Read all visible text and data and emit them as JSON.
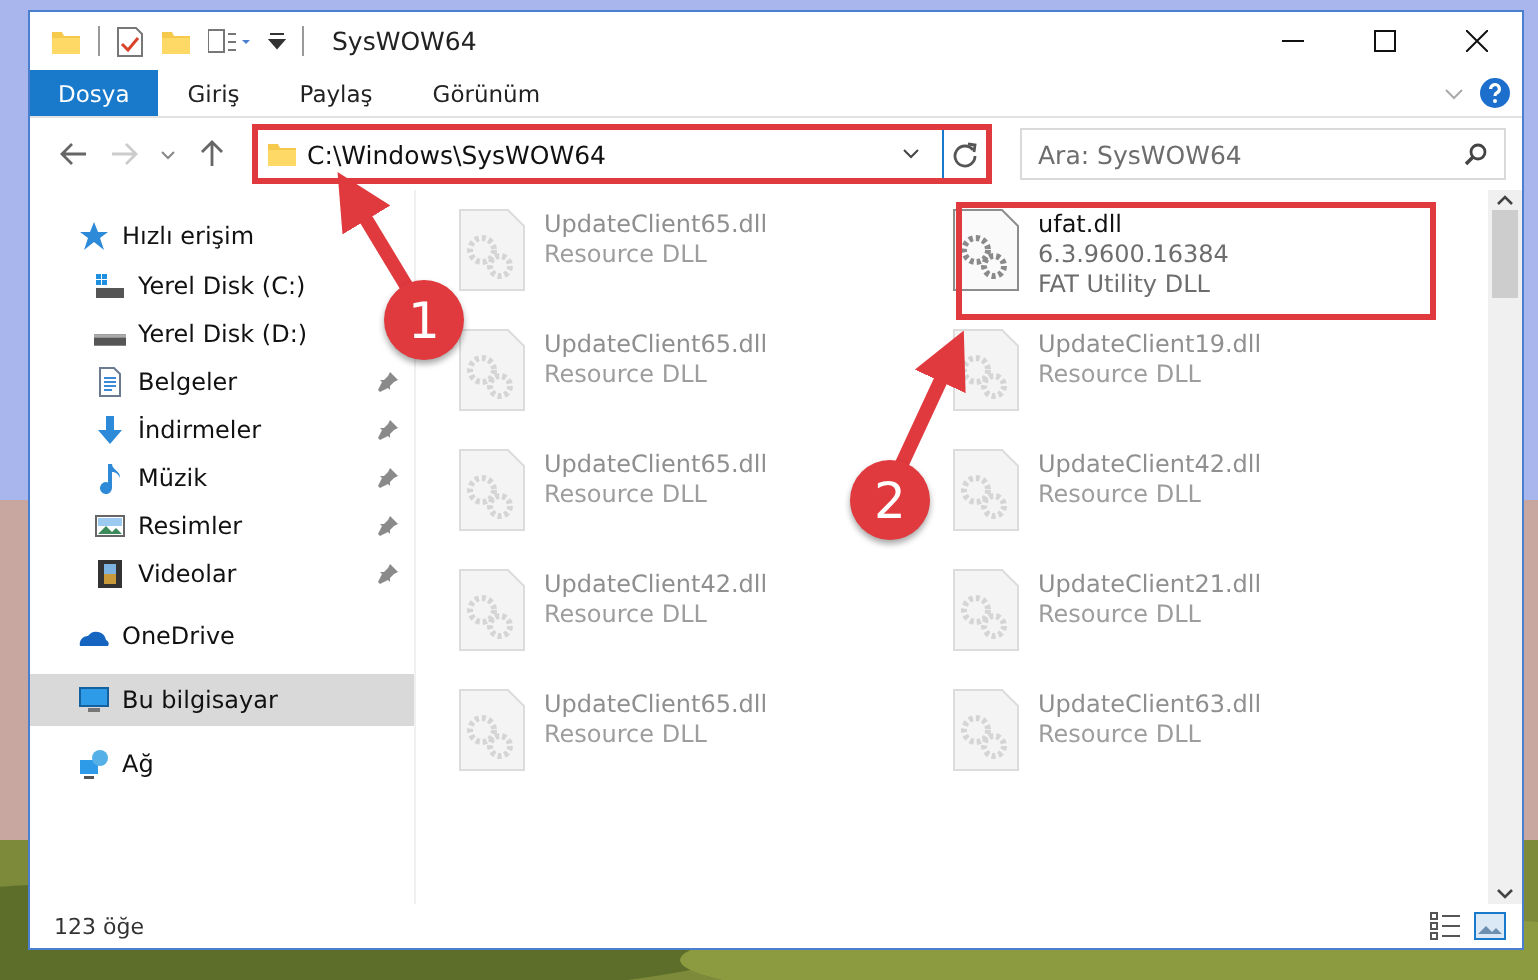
{
  "window": {
    "title": "SysWOW64"
  },
  "ribbon_tabs": [
    {
      "label": "Dosya",
      "selected": true
    },
    {
      "label": "Giriş",
      "selected": false
    },
    {
      "label": "Paylaş",
      "selected": false
    },
    {
      "label": "Görünüm",
      "selected": false
    }
  ],
  "address_bar": {
    "path": "C:\\Windows\\SysWOW64"
  },
  "search": {
    "placeholder": "Ara: SysWOW64"
  },
  "sidebar": {
    "items": [
      {
        "label": "Hızlı erişim",
        "kind": "star",
        "selected": false,
        "children": [
          {
            "label": "Yerel Disk (C:)",
            "kind": "system-drive",
            "pinned": false,
            "selected": false
          },
          {
            "label": "Yerel Disk (D:)",
            "kind": "drive",
            "pinned": false,
            "selected": false
          },
          {
            "label": "Belgeler",
            "kind": "documents",
            "pinned": true,
            "selected": false
          },
          {
            "label": "İndirmeler",
            "kind": "downloads",
            "pinned": true,
            "selected": false
          },
          {
            "label": "Müzik",
            "kind": "music",
            "pinned": true,
            "selected": false
          },
          {
            "label": "Resimler",
            "kind": "pictures",
            "pinned": true,
            "selected": false
          },
          {
            "label": "Videolar",
            "kind": "videos",
            "pinned": true,
            "selected": false
          }
        ]
      },
      {
        "label": "OneDrive",
        "kind": "cloud",
        "selected": false
      },
      {
        "label": "Bu bilgisayar",
        "kind": "computer",
        "selected": true
      },
      {
        "label": "Ağ",
        "kind": "network",
        "selected": false
      }
    ]
  },
  "files": [
    {
      "name": "UpdateClient65.dll",
      "description": "Resource DLL",
      "highlighted": false
    },
    {
      "name": "ufat.dll",
      "version": "6.3.9600.16384",
      "description": "FAT Utility DLL",
      "highlighted": true
    },
    {
      "name": "UpdateClient65.dll",
      "description": "Resource DLL",
      "highlighted": false
    },
    {
      "name": "UpdateClient19.dll",
      "description": "Resource DLL",
      "highlighted": false
    },
    {
      "name": "UpdateClient65.dll",
      "description": "Resource DLL",
      "highlighted": false
    },
    {
      "name": "UpdateClient42.dll",
      "description": "Resource DLL",
      "highlighted": false
    },
    {
      "name": "UpdateClient42.dll",
      "description": "Resource DLL",
      "highlighted": false
    },
    {
      "name": "UpdateClient21.dll",
      "description": "Resource DLL",
      "highlighted": false
    },
    {
      "name": "UpdateClient65.dll",
      "description": "Resource DLL",
      "highlighted": false
    },
    {
      "name": "UpdateClient63.dll",
      "description": "Resource DLL",
      "highlighted": false
    }
  ],
  "annotations": [
    {
      "number": "1"
    },
    {
      "number": "2"
    }
  ],
  "status_bar": {
    "count": "123 öğe"
  }
}
